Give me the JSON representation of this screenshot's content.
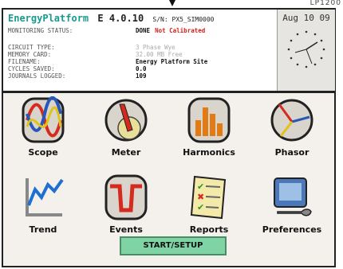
{
  "top_note": "LP1200",
  "header": {
    "brand_a": "Energy",
    "brand_b": "Platform",
    "model": "E 4.0.10",
    "serial": "S/N: PX5_SIM0000",
    "monitoring_label": "MONITORING STATUS:",
    "monitoring_value": "DONE",
    "monitoring_flag": "Not Calibrated",
    "rows": [
      {
        "label": "CIRCUIT TYPE:",
        "value": "3 Phase Wye"
      },
      {
        "label": "MEMORY CARD:",
        "value": "32.00 MB Free"
      },
      {
        "label": "FILENAME:",
        "value": "Energy Platform Site"
      },
      {
        "label": "CYCLES SAVED:",
        "value": "0.0"
      },
      {
        "label": "JOURNALS LOGGED:",
        "value": "109"
      }
    ],
    "date": "Aug 10 09"
  },
  "tiles": [
    {
      "label": "Scope",
      "icon": "scope-icon"
    },
    {
      "label": "Meter",
      "icon": "meter-icon"
    },
    {
      "label": "Harmonics",
      "icon": "harmonics-icon"
    },
    {
      "label": "Phasor",
      "icon": "phasor-icon"
    },
    {
      "label": "Trend",
      "icon": "trend-icon"
    },
    {
      "label": "Events",
      "icon": "events-icon"
    },
    {
      "label": "Reports",
      "icon": "reports-icon"
    },
    {
      "label": "Preferences",
      "icon": "preferences-icon"
    }
  ],
  "start_button": "START/SETUP",
  "colors": {
    "accent": "#1a9a8e",
    "alert": "#d0201c",
    "button": "#7fd3a4"
  }
}
